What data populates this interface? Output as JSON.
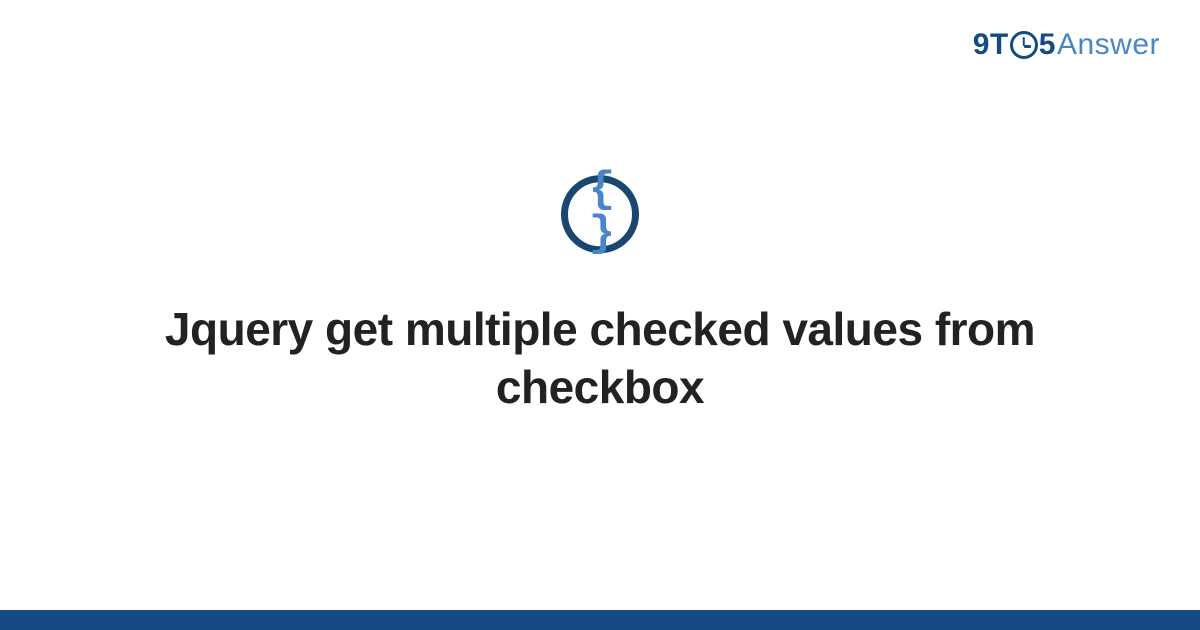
{
  "brand": {
    "part1": "9T",
    "part2": "5",
    "part3": "Answer"
  },
  "icon": {
    "glyph": "{ }",
    "name": "code-braces-icon"
  },
  "title": "Jquery get multiple checked values from checkbox",
  "colors": {
    "darkBlue": "#154b84",
    "lightBlue": "#4a86c7",
    "text": "#222222"
  }
}
